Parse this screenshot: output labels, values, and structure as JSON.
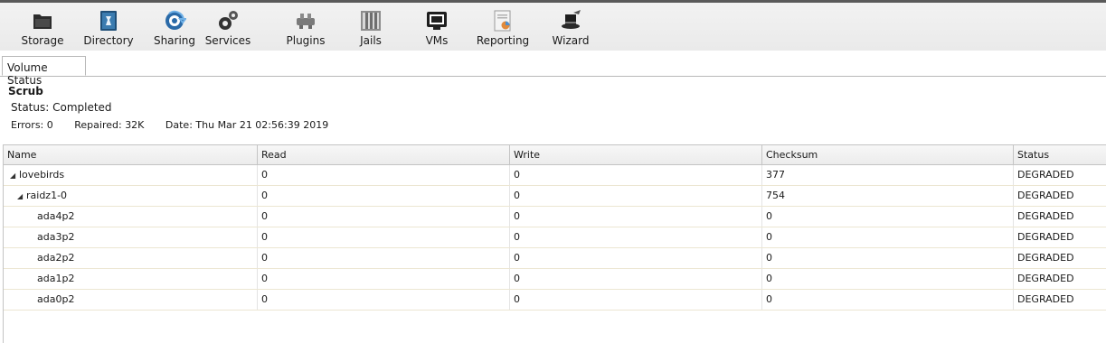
{
  "toolbar": {
    "items": [
      {
        "label": "Storage"
      },
      {
        "label": "Directory"
      },
      {
        "label": "Sharing"
      },
      {
        "label": "Services"
      },
      {
        "label": "Plugins"
      },
      {
        "label": "Jails"
      },
      {
        "label": "VMs"
      },
      {
        "label": "Reporting"
      },
      {
        "label": "Wizard"
      }
    ]
  },
  "tab": {
    "label": "Volume Status"
  },
  "scrub": {
    "title": "Scrub",
    "status": "Status: Completed",
    "errors_label": "Errors:",
    "errors_value": "0",
    "repaired_label": "Repaired:",
    "repaired_value": "32K",
    "date_label": "Date:",
    "date_value": "Thu Mar 21 02:56:39 2019"
  },
  "table": {
    "columns": [
      "Name",
      "Read",
      "Write",
      "Checksum",
      "Status"
    ],
    "expander_glyph": "◢",
    "rows": [
      {
        "name": "lovebirds",
        "read": "0",
        "write": "0",
        "checksum": "377",
        "status": "DEGRADED"
      },
      {
        "name": "raidz1-0",
        "read": "0",
        "write": "0",
        "checksum": "754",
        "status": "DEGRADED"
      },
      {
        "name": "ada4p2",
        "read": "0",
        "write": "0",
        "checksum": "0",
        "status": "DEGRADED"
      },
      {
        "name": "ada3p2",
        "read": "0",
        "write": "0",
        "checksum": "0",
        "status": "DEGRADED"
      },
      {
        "name": "ada2p2",
        "read": "0",
        "write": "0",
        "checksum": "0",
        "status": "DEGRADED"
      },
      {
        "name": "ada1p2",
        "read": "0",
        "write": "0",
        "checksum": "0",
        "status": "DEGRADED"
      },
      {
        "name": "ada0p2",
        "read": "0",
        "write": "0",
        "checksum": "0",
        "status": "DEGRADED"
      }
    ]
  }
}
